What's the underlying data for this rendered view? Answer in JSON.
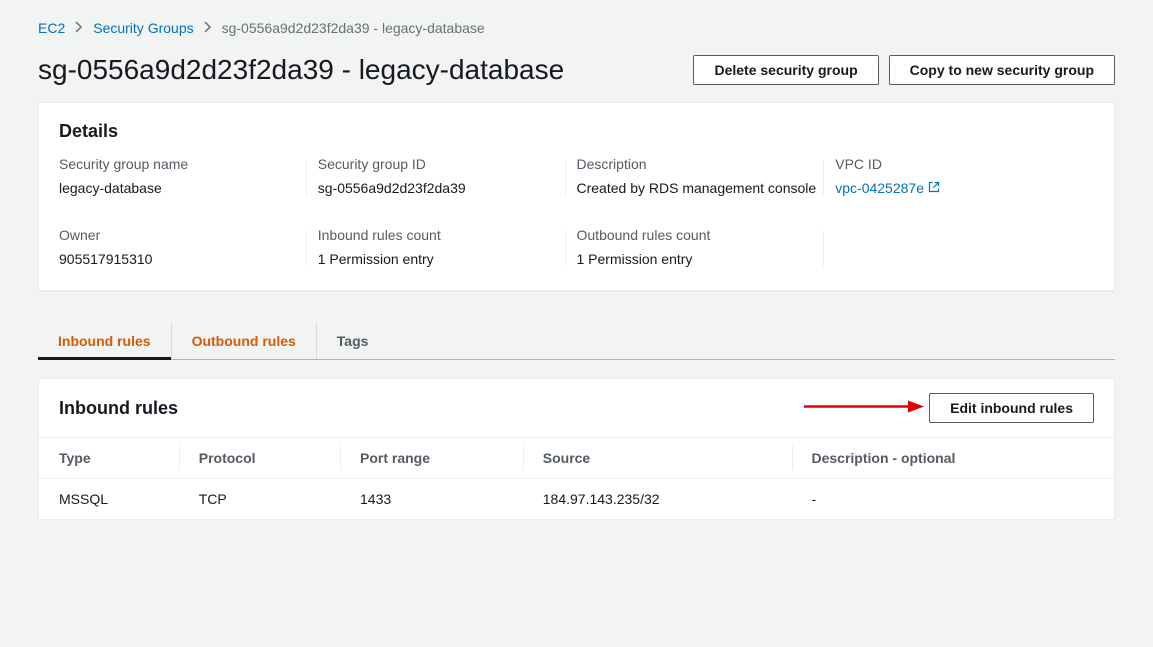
{
  "breadcrumb": {
    "items": [
      "EC2",
      "Security Groups"
    ],
    "current": "sg-0556a9d2d23f2da39 - legacy-database"
  },
  "page_title": "sg-0556a9d2d23f2da39 - legacy-database",
  "actions": {
    "delete": "Delete security group",
    "copy": "Copy to new security group"
  },
  "details": {
    "heading": "Details",
    "fields": {
      "sg_name_label": "Security group name",
      "sg_name_value": "legacy-database",
      "sg_id_label": "Security group ID",
      "sg_id_value": "sg-0556a9d2d23f2da39",
      "desc_label": "Description",
      "desc_value": "Created by RDS management console",
      "vpc_label": "VPC ID",
      "vpc_value": "vpc-0425287e",
      "owner_label": "Owner",
      "owner_value": "905517915310",
      "inbound_count_label": "Inbound rules count",
      "inbound_count_value": "1 Permission entry",
      "outbound_count_label": "Outbound rules count",
      "outbound_count_value": "1 Permission entry"
    }
  },
  "tabs": {
    "inbound": "Inbound rules",
    "outbound": "Outbound rules",
    "tags": "Tags"
  },
  "rules": {
    "heading": "Inbound rules",
    "edit_button": "Edit inbound rules",
    "columns": {
      "type": "Type",
      "protocol": "Protocol",
      "port_range": "Port range",
      "source": "Source",
      "description": "Description - optional"
    },
    "rows": [
      {
        "type": "MSSQL",
        "protocol": "TCP",
        "port_range": "1433",
        "source": "184.97.143.235/32",
        "description": "-"
      }
    ]
  }
}
